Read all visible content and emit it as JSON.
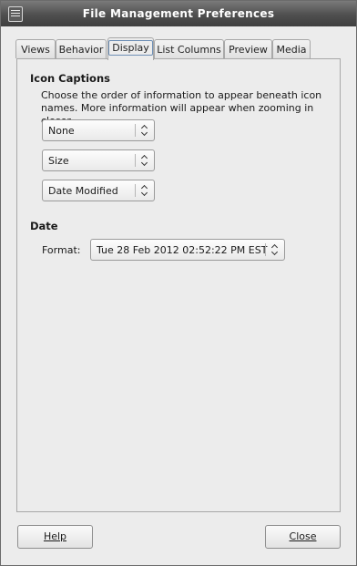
{
  "window": {
    "title": "File Management Preferences"
  },
  "tabs": [
    {
      "label": "Views"
    },
    {
      "label": "Behavior"
    },
    {
      "label": "Display",
      "active": true
    },
    {
      "label": "List Columns"
    },
    {
      "label": "Preview"
    },
    {
      "label": "Media"
    }
  ],
  "icon_captions": {
    "title": "Icon Captions",
    "description": "Choose the order of information to appear beneath icon names. More information will appear when zooming in closer.",
    "selects": [
      "None",
      "Size",
      "Date Modified"
    ]
  },
  "date": {
    "title": "Date",
    "format_label": "Format:",
    "format_value": "Tue 28 Feb 2012 02:52:22 PM EST"
  },
  "buttons": {
    "help": "Help",
    "close": "Close"
  }
}
